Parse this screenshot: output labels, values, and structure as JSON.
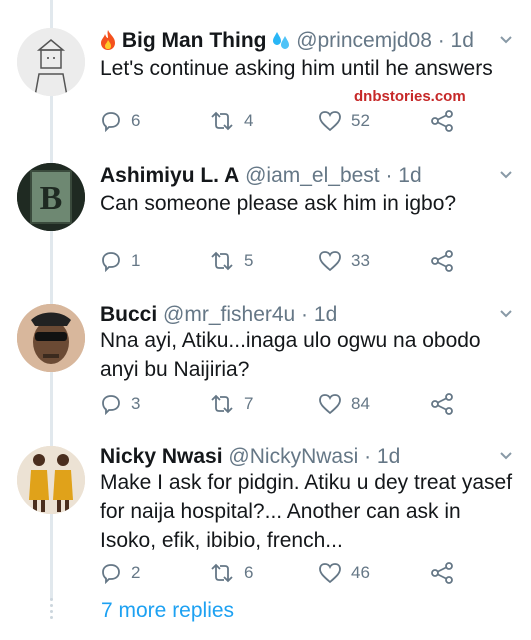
{
  "colors": {
    "link": "#1da1f2",
    "muted": "#657786",
    "text": "#14171a",
    "watermark": "#c62828"
  },
  "watermark": "dnbstories.com",
  "tweets": [
    {
      "name": "Big Man Thing",
      "name_prefix_icon": "fire-emoji",
      "name_suffix_icon": "droplets-emoji",
      "handle": "@princemjd08 · 1d",
      "text": "Let's continue asking him until he answers",
      "replies": "6",
      "retweets": "4",
      "likes": "52"
    },
    {
      "name": "Ashimiyu L. A",
      "handle": "@iam_el_best · 1d",
      "text": "Can someone please ask him in igbo?",
      "replies": "1",
      "retweets": "5",
      "likes": "33"
    },
    {
      "name": "Bucci",
      "handle": "@mr_fisher4u · 1d",
      "text": "Nna ayi, Atiku...inaga ulo ogwu na obodo anyi bu Naijiria?",
      "replies": "3",
      "retweets": "7",
      "likes": "84"
    },
    {
      "name": "Nicky Nwasi",
      "handle": "@NickyNwasi · 1d",
      "text": "Make I ask for pidgin. Atiku u dey treat yasef for naija hospital?... Another can ask in Isoko, efik, ibibio, french...",
      "replies": "2",
      "retweets": "6",
      "likes": "46"
    }
  ],
  "more_replies": "7 more replies"
}
